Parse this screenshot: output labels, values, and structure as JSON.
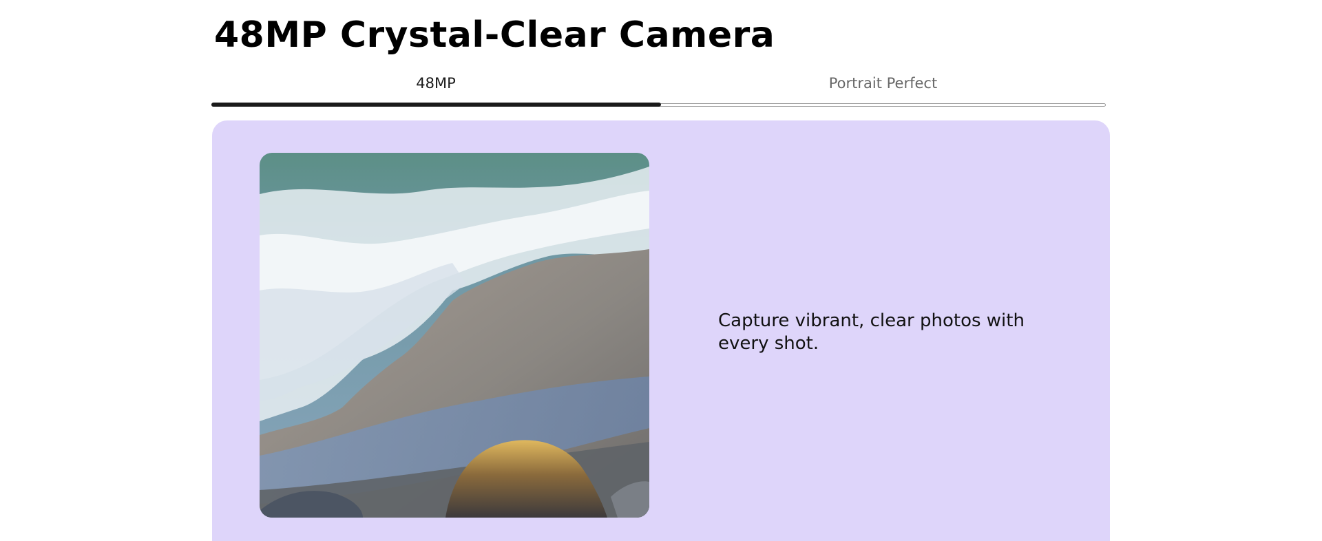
{
  "header": {
    "title": "48MP Crystal-Clear Camera"
  },
  "tabs": [
    {
      "label": "48MP",
      "active": true
    },
    {
      "label": "Portrait Perfect",
      "active": false
    }
  ],
  "progress": {
    "fraction": 0.5
  },
  "feature": {
    "image_subject": "beach-waves-photo",
    "caption": "Capture vibrant, clear photos with every shot."
  },
  "colors": {
    "panel_background": "#ded5fa",
    "active_tab_indicator": "#1a1a1a",
    "inactive_tab_text": "#666666"
  }
}
